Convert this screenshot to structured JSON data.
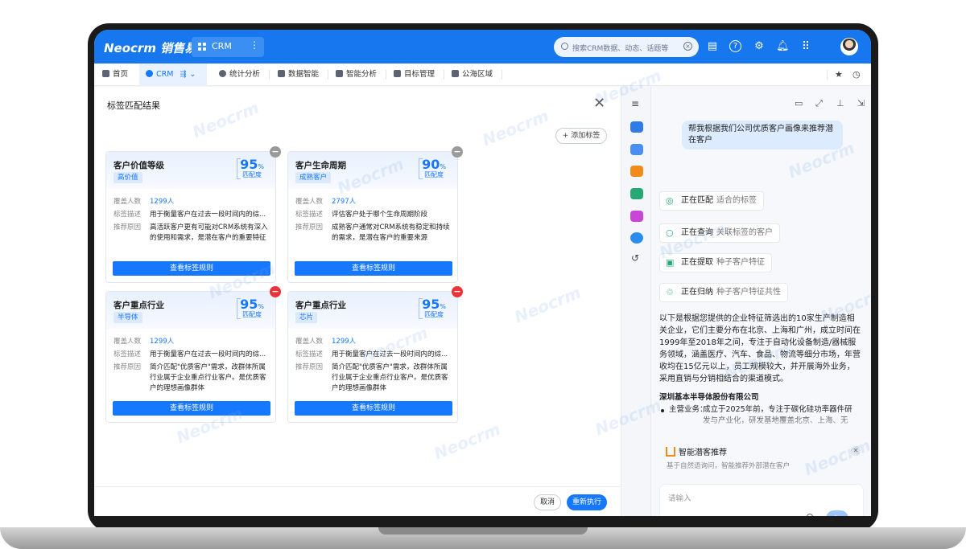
{
  "brand": {
    "logo": "Neocrm 销售易",
    "accent": "#1777ef",
    "primary_button": "#1677ff",
    "danger": "#e8333a"
  },
  "topbar": {
    "app_switch_label": "CRM",
    "search_placeholder": "搜索CRM数据、动态、话题等",
    "icons": [
      "doc-icon",
      "help-icon",
      "gear-icon",
      "bell-icon",
      "apps-icon"
    ]
  },
  "nav": {
    "items": [
      {
        "label": "首页",
        "icon": "home-icon"
      },
      {
        "label": "CRM",
        "icon": "crm-icon",
        "active": true
      },
      {
        "label": "统计分析",
        "icon": "pie-icon"
      },
      {
        "label": "数据智能",
        "icon": "data-icon"
      },
      {
        "label": "智能分析",
        "icon": "analysis-icon"
      },
      {
        "label": "目标管理",
        "icon": "target-icon"
      },
      {
        "label": "公海区域",
        "icon": "sea-icon"
      }
    ]
  },
  "panel": {
    "title": "标签匹配结果",
    "add_tag": "+ 添加标签",
    "cancel": "取消",
    "rerun": "重新执行",
    "field_labels": {
      "coverage": "覆盖人数",
      "desc": "标签描述",
      "reason": "推荐原因"
    },
    "match_caption": "匹配度",
    "rule_button": "查看标签规则",
    "cards": [
      {
        "name": "客户价值等级",
        "badge": "高价值",
        "score": "95",
        "pct": "%",
        "coverage": "1299人",
        "desc": "用于衡量客户在过去一段时间内的综...",
        "reason": "高活跃客户更有可能对CRM系统有深入的使用和需求，是潜在客户的重要特征"
      },
      {
        "name": "客户生命周期",
        "badge": "成熟客户",
        "score": "90",
        "pct": "%",
        "coverage": "2797人",
        "desc": "评估客户处于哪个生命周期阶段",
        "reason": "成熟客户通常对CRM系统有稳定和持续的需求，是潜在客户的重要来源"
      },
      {
        "name": "客户重点行业",
        "badge": "半导体",
        "score": "95",
        "pct": "%",
        "coverage": "1299人",
        "desc": "用于衡量客户在过去一段时间内的综...",
        "reason": "简介匹配\"优质客户\"需求，改群体所属行业属于企业重点行业客户。是优质客户的理想画像群体"
      },
      {
        "name": "客户重点行业",
        "badge": "芯片",
        "score": "95",
        "pct": "%",
        "coverage": "1299人",
        "desc": "用于衡量客户在过去一段时间内的综...",
        "reason": "简介匹配\"优质客户\"需求，改群体所属行业属于企业重点行业客户。是优质客户的理想画像群体"
      }
    ]
  },
  "assistant": {
    "user_message": "帮我根据我们公司优质客户画像来推荐潜在客户",
    "steps": [
      {
        "verb": "正在匹配",
        "object": "适合的标签",
        "icon": "target-icon"
      },
      {
        "verb": "正在查询",
        "object": "关联标签的客户",
        "icon": "search-icon"
      },
      {
        "verb": "正在提取",
        "object": "种子客户特征",
        "icon": "extract-icon"
      },
      {
        "verb": "正在归纳",
        "object": "种子客户特征共性",
        "icon": "recycle-icon"
      }
    ],
    "answer": "以下是根据您提供的企业特征筛选出的10家生产制造相关企业，它们主要分布在北京、上海和广州，成立时间在1999年至2018年之间，专注于自动化设备制造/器械服务领域，涵盖医疗、汽车、食品、物流等细分市场，年营收均在15亿元以上，员工规模较大，并开展海外业务，采用直销与分销相结合的渠道模式。",
    "company": "深圳基本半导体股份有限公司",
    "bullet_key": "主营业务：",
    "bullet_value": "成立于2025年前，专注于碳化硅功率器件研发与产业化，研发基地覆盖北京、上海、无锡、深圳等多个城市",
    "recommend_title": "智能潜客推荐",
    "recommend_sub": "基于自然语询问，智能推荐外部潜在客户",
    "input_placeholder": "请输入"
  },
  "watermark": "Neocrm"
}
